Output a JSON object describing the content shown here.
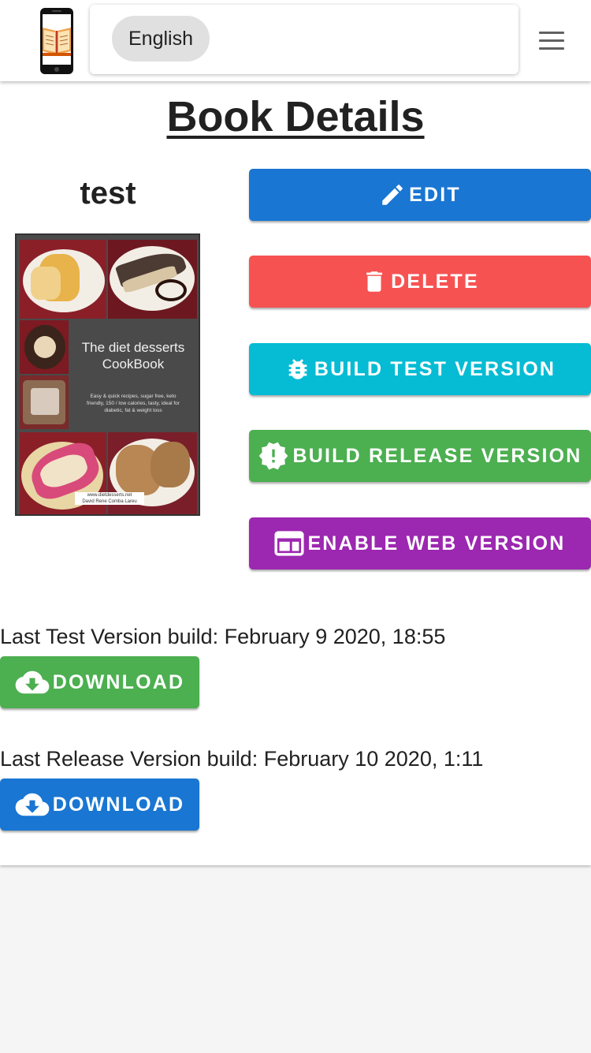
{
  "header": {
    "language_label": "English"
  },
  "page": {
    "title": "Book Details"
  },
  "book": {
    "name": "test",
    "cover_title_line1": "The diet desserts",
    "cover_title_line2": "CookBook",
    "cover_desc": "Easy & quick recipes, sugar free, keto friendly, 150 / low calories, tasty, ideal for diabetic, fat & weight loss",
    "cover_footer_line1": "www.dietdesserts.net",
    "cover_footer_line2": "David Rene Comba Lareu"
  },
  "actions": {
    "edit_label": "EDIT",
    "delete_label": "DELETE",
    "build_test_label": "BUILD TEST VERSION",
    "build_release_label": "BUILD RELEASE VERSION",
    "enable_web_label": "ENABLE WEB VERSION"
  },
  "builds": {
    "test_text": "Last Test Version build: February 9 2020, 18:55",
    "test_download_label": "DOWNLOAD",
    "release_text": "Last Release Version build: February 10 2020, 1:11",
    "release_download_label": "DOWNLOAD"
  },
  "colors": {
    "edit": "#1976d2",
    "delete": "#f75252",
    "build_test": "#06bcd4",
    "build_release": "#4caf50",
    "enable_web": "#9c27b0",
    "download_test": "#4caf50",
    "download_release": "#1976d2"
  },
  "icons": {
    "edit": "pencil-icon",
    "delete": "trash-icon",
    "build_test": "bug-icon",
    "build_release": "alert-decagram-icon",
    "enable_web": "web-window-icon",
    "download": "cloud-download-icon",
    "menu": "hamburger-menu-icon"
  }
}
